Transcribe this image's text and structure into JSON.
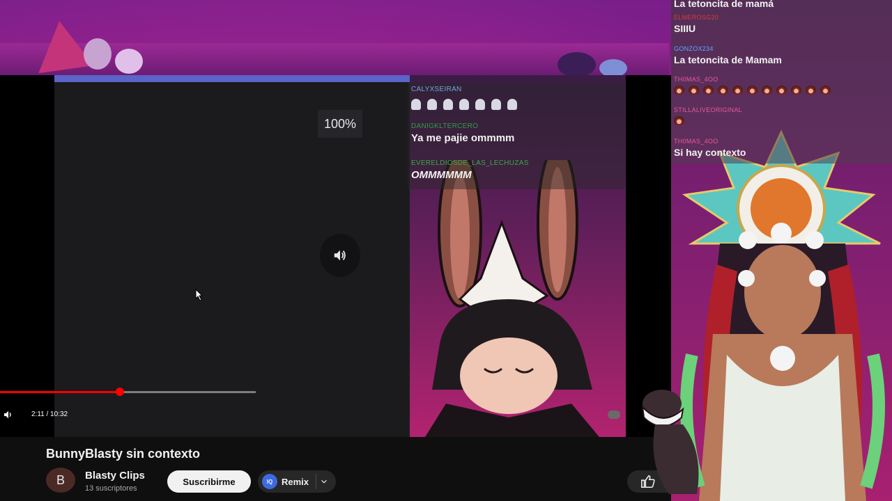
{
  "player": {
    "zoom_level": "100%",
    "time": "2:11 / 10:32",
    "progress_fraction": 0.467
  },
  "inner_chat": [
    {
      "name": "CALYXSEIRAN",
      "color": "#6fa8dc",
      "text": "",
      "emote_count": 7
    },
    {
      "name": "DANIGKLTERCERO",
      "color": "#2e9e4a",
      "text": "Ya me pajie ommmm"
    },
    {
      "name": "EVERELDIOSDE_LAS_LECHUZAS",
      "color": "#3aa84a",
      "text": "OMMMMMM"
    }
  ],
  "video": {
    "title": "BunnyBlasty sin contexto",
    "channel": "Blasty Clips",
    "avatar_letter": "B",
    "subscribers": "13 suscriptores",
    "subscribe_label": "Suscribirme",
    "remix_label": "Remix",
    "remix_badge": "IQ"
  },
  "chat": [
    {
      "name": "",
      "color": "#e0e0e0",
      "text": "La tetoncita de mamá"
    },
    {
      "name": "ELMEROSG20",
      "color": "#d93a3a",
      "text": "SIIIU"
    },
    {
      "name": "GONZOX234",
      "color": "#5aa8ff",
      "text": "La tetoncita de Mamam"
    },
    {
      "name": "TH0MAS_4OO",
      "color": "#e85a9a",
      "text": "",
      "emote_count": 11
    },
    {
      "name": "STILLALIVEORIGINAL",
      "color": "#e85a9a",
      "text": "",
      "emote_count": 1
    },
    {
      "name": "TH0MAS_4OO",
      "color": "#e85a9a",
      "text": "Si hay contexto"
    }
  ]
}
